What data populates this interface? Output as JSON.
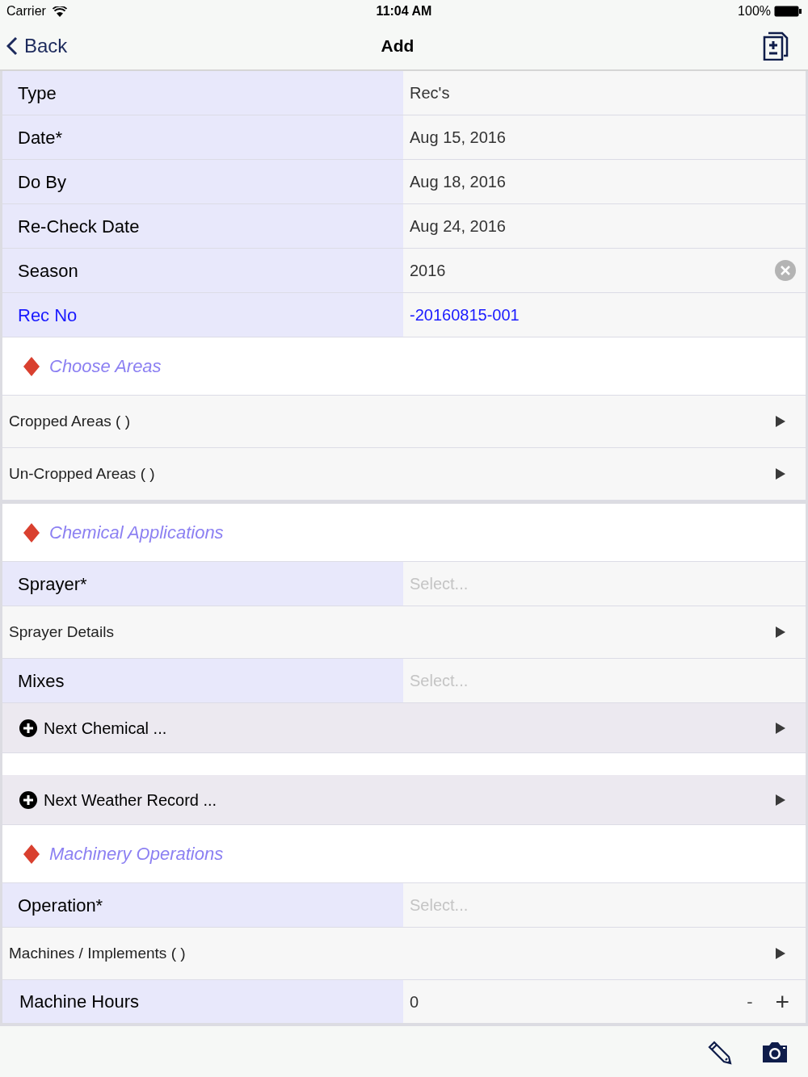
{
  "status_bar": {
    "carrier": "Carrier",
    "time": "11:04 AM",
    "battery": "100%"
  },
  "nav_bar": {
    "back": "Back",
    "title": "Add"
  },
  "rows": [
    {
      "kind": "field",
      "label": "Type",
      "value": "Rec's"
    },
    {
      "kind": "field",
      "label": "Date*",
      "value": "Aug 15, 2016"
    },
    {
      "kind": "field",
      "label": "Do By",
      "value": "Aug 18, 2016"
    },
    {
      "kind": "field",
      "label": "Re-Check Date",
      "value": "Aug 24, 2016"
    },
    {
      "kind": "field",
      "label": "Season",
      "value": "2016",
      "clearable": true
    },
    {
      "kind": "field",
      "label": "Rec No",
      "value": "-20160815-001",
      "link": true
    },
    {
      "kind": "section",
      "title": "Choose Areas"
    },
    {
      "kind": "nav",
      "label": "Cropped Areas ( )"
    },
    {
      "kind": "nav",
      "label": "Un-Cropped Areas ( )"
    },
    {
      "kind": "divider"
    },
    {
      "kind": "section",
      "title": "Chemical Applications"
    },
    {
      "kind": "field",
      "label": "Sprayer*",
      "placeholder": "Select..."
    },
    {
      "kind": "nav",
      "label": "Sprayer Details"
    },
    {
      "kind": "field",
      "label": "Mixes",
      "placeholder": "Select..."
    },
    {
      "kind": "add",
      "label": "Next Chemical ..."
    },
    {
      "kind": "gap"
    },
    {
      "kind": "add",
      "label": "Next Weather Record ..."
    },
    {
      "kind": "section",
      "title": "Machinery Operations"
    },
    {
      "kind": "field",
      "label": "Operation*",
      "placeholder": "Select..."
    },
    {
      "kind": "nav",
      "label": "Machines / Implements ( )"
    },
    {
      "kind": "stepper",
      "label": "Machine Hours",
      "value": "0",
      "minus": "-",
      "plus": "+"
    }
  ]
}
